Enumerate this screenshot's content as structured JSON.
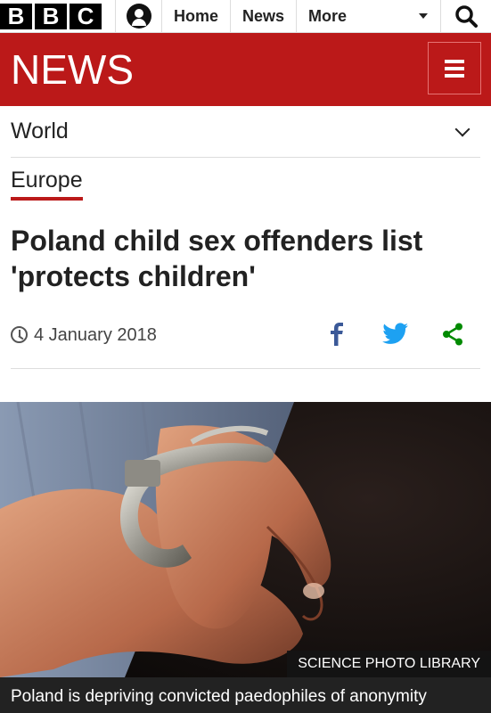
{
  "brand": {
    "letters": [
      "B",
      "B",
      "C"
    ]
  },
  "topnav": {
    "home": "Home",
    "news": "News",
    "more": "More"
  },
  "newsbar": {
    "title": "NEWS",
    "accent": "#bb1919"
  },
  "section": {
    "label": "World"
  },
  "subsection": {
    "label": "Europe"
  },
  "article": {
    "headline": "Poland child sex offenders list 'protects children'",
    "date": "4 January 2018"
  },
  "image": {
    "credit": "SCIENCE PHOTO LIBRARY",
    "caption": "Poland is depriving convicted paedophiles of anonymity"
  },
  "icons": {
    "account": "user-icon",
    "search": "search-icon",
    "menu": "hamburger-icon",
    "clock": "clock-icon",
    "facebook": "facebook-icon",
    "twitter": "twitter-icon",
    "share": "share-icon"
  },
  "colors": {
    "facebook": "#3b5998",
    "twitter": "#1da1f2",
    "share": "#008a00"
  }
}
